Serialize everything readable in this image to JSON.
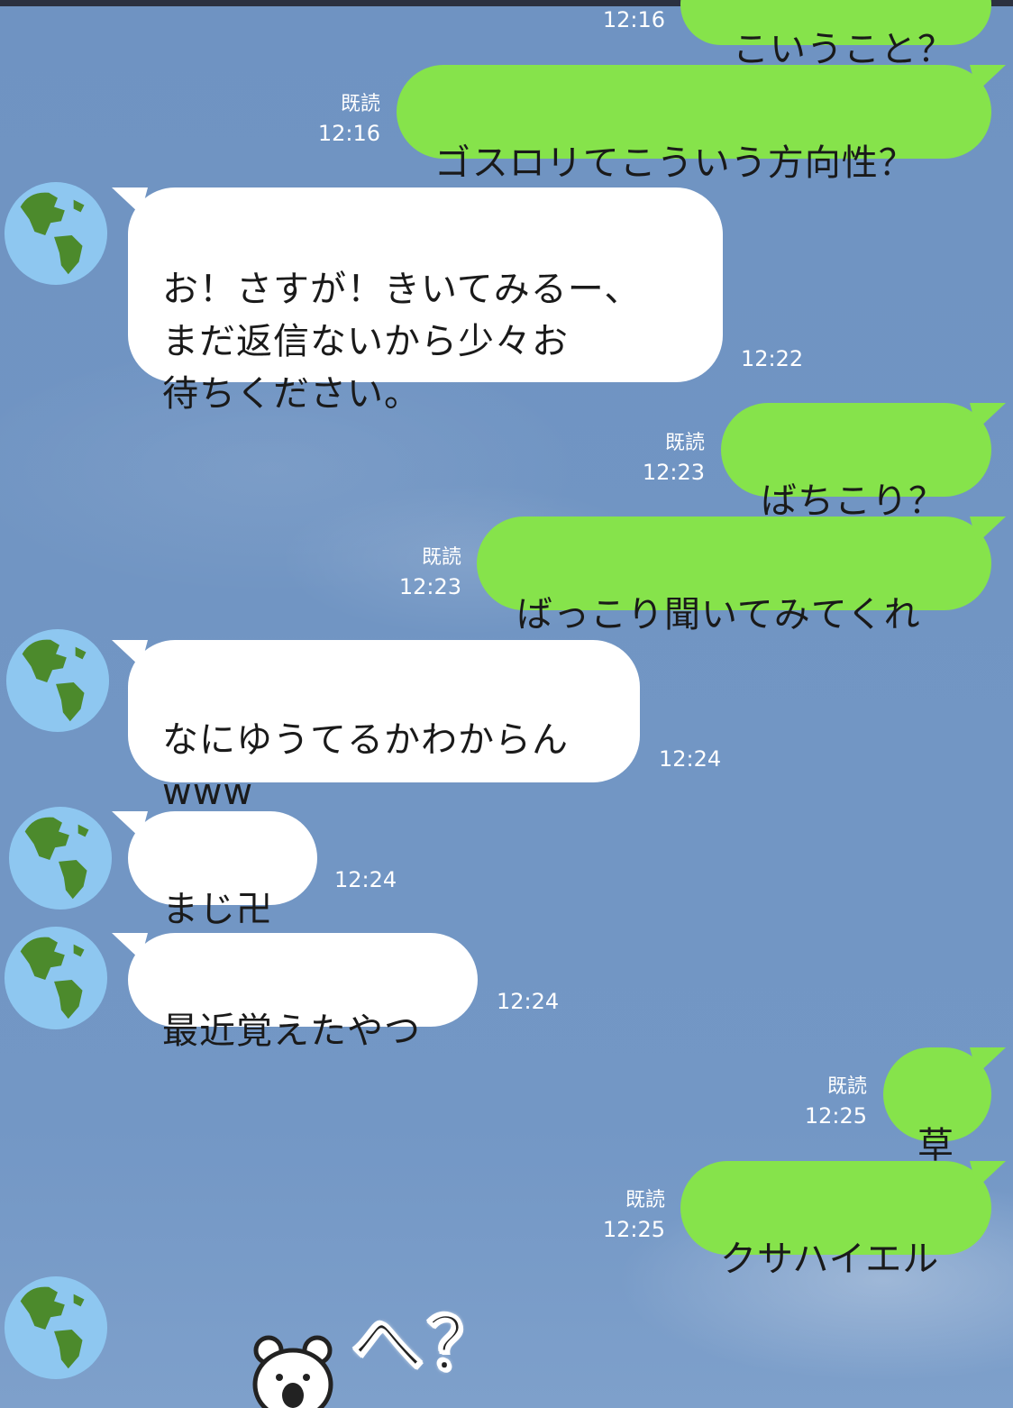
{
  "messages": [
    {
      "side": "me",
      "text": "こいうこと？",
      "read": "",
      "time": "12:16"
    },
    {
      "side": "me",
      "text": "ゴスロリてこういう方向性？",
      "read": "既読",
      "time": "12:16"
    },
    {
      "side": "them",
      "text": "お！さすが！きいてみるー、\nまだ返信ないから少々お\n待ちください。",
      "time": "12:22"
    },
    {
      "side": "me",
      "text": "ばちこり？",
      "read": "既読",
      "time": "12:23"
    },
    {
      "side": "me",
      "text": "ばっこり聞いてみてくれ",
      "read": "既読",
      "time": "12:23"
    },
    {
      "side": "them",
      "text": "なにゆうてるかわからん\nwww",
      "time": "12:24"
    },
    {
      "side": "them",
      "text": "まじ卍",
      "time": "12:24"
    },
    {
      "side": "them",
      "text": "最近覚えたやつ",
      "time": "12:24"
    },
    {
      "side": "me",
      "text": "草",
      "read": "既読",
      "time": "12:25"
    },
    {
      "side": "me",
      "text": "クサハイエル",
      "read": "既読",
      "time": "12:25"
    }
  ],
  "sticker": {
    "text": "へ？",
    "icon": "bear-sticker-icon"
  },
  "avatar_icon": "earth-globe-icon",
  "colors": {
    "my_bubble": "#86e34b",
    "their_bubble": "#ffffff",
    "background": "#7195c3"
  }
}
